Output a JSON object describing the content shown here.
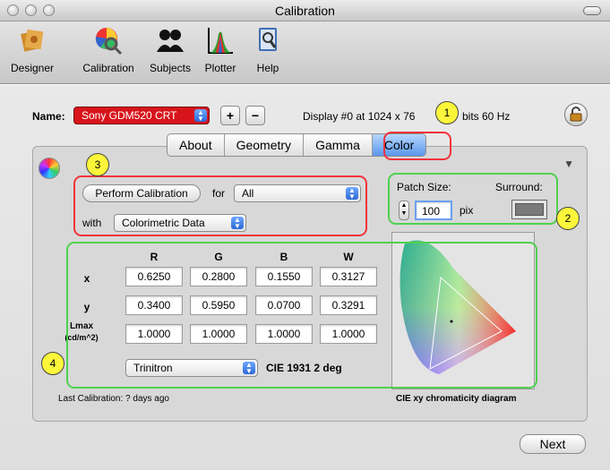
{
  "window": {
    "title": "Calibration"
  },
  "toolbar": {
    "items": [
      {
        "label": "Designer",
        "icon": "designer-icon"
      },
      {
        "label": "Calibration",
        "icon": "calibration-icon"
      },
      {
        "label": "Subjects",
        "icon": "subjects-icon"
      },
      {
        "label": "Plotter",
        "icon": "plotter-icon"
      },
      {
        "label": "Help",
        "icon": "help-icon"
      }
    ]
  },
  "display": {
    "name_label": "Name:",
    "name_value": "Sony GDM520 CRT",
    "plus_label": "+",
    "minus_label": "−",
    "info_part1": "Display #0 at 1024 x 76",
    "info_part2": "bits  60 Hz"
  },
  "tabs": [
    {
      "label": "About",
      "active": false
    },
    {
      "label": "Geometry",
      "active": false
    },
    {
      "label": "Gamma",
      "active": false
    },
    {
      "label": "Color",
      "active": true
    }
  ],
  "calibration": {
    "perform_button": "Perform Calibration",
    "for_label": "for",
    "for_value": "All",
    "with_label": "with",
    "with_value": "Colorimetric Data"
  },
  "patch": {
    "size_label": "Patch Size:",
    "size_value": "100",
    "unit": "pix",
    "surround_label": "Surround:"
  },
  "color_table": {
    "columns": [
      "R",
      "G",
      "B",
      "W"
    ],
    "rows": [
      {
        "label": "x",
        "values": [
          "0.6250",
          "0.2800",
          "0.1550",
          "0.3127"
        ]
      },
      {
        "label": "y",
        "values": [
          "0.3400",
          "0.5950",
          "0.0700",
          "0.3291"
        ]
      },
      {
        "label": "Lmax",
        "sublabel": "(cd/m^2)",
        "values": [
          "1.0000",
          "1.0000",
          "1.0000",
          "1.0000"
        ]
      }
    ]
  },
  "phosphor": {
    "value": "Trinitron",
    "observer": "CIE 1931 2 deg"
  },
  "diagram_caption": "CIE xy chromaticity diagram",
  "last_calibration": "Last Calibration: ? days ago",
  "next_button": "Next",
  "callouts": [
    "1",
    "2",
    "3",
    "4"
  ],
  "colors": {
    "highlight_red": "#f2333a",
    "highlight_green": "#4fd14f",
    "badge_yellow": "#fcf63b",
    "active_tab": "#5a97ea",
    "name_field_bg": "#d8141b"
  }
}
